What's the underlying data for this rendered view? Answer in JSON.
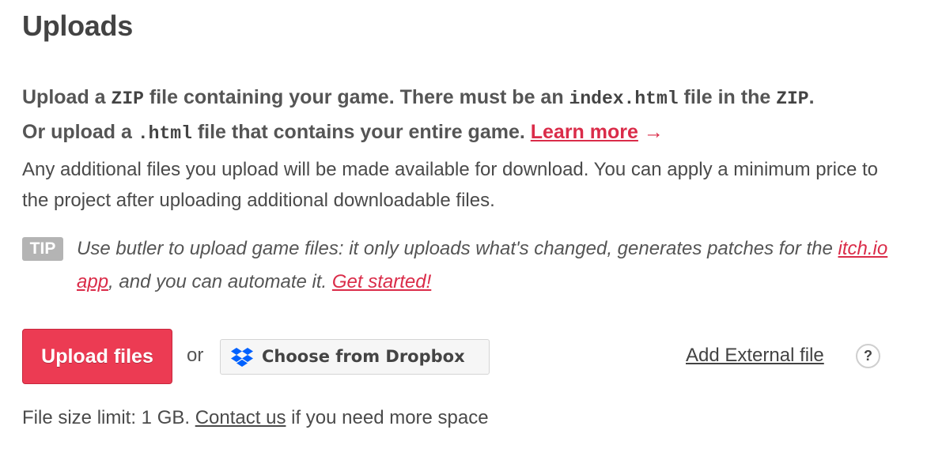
{
  "title": "Uploads",
  "intro": {
    "p1a": "Upload a ",
    "code_zip": "ZIP",
    "p1b": " file containing your game. There must be an ",
    "code_index": "index.html",
    "p1c": " file in the ",
    "code_zip2": "ZIP",
    "p1d": ".",
    "p2a": "Or upload a ",
    "code_html": ".html",
    "p2b": " file that contains your entire game. ",
    "learn_more": "Learn more",
    "arrow": "→"
  },
  "info_text": "Any additional files you upload will be made available for download. You can apply a minimum price to the project after uploading additional downloadable files.",
  "tip": {
    "badge": "TIP",
    "text_a": "Use butler to upload game files: it only uploads what's changed, generates patches for the ",
    "link_app": "itch.io app",
    "text_b": ", and you can automate it. ",
    "link_started": "Get started!"
  },
  "actions": {
    "upload_label": "Upload files",
    "or_label": "or",
    "dropbox_label": "Choose from Dropbox",
    "dropbox_icon": "dropbox-icon",
    "external_label": "Add External file",
    "help_symbol": "?"
  },
  "limit": {
    "text_a": "File size limit: 1 GB. ",
    "contact": "Contact us",
    "text_b": " if you need more space"
  },
  "colors": {
    "accent": "#da2c49",
    "upload_button": "#ec3b53",
    "tip_badge": "#b4b4b4",
    "dropbox_blue": "#0061fe"
  }
}
